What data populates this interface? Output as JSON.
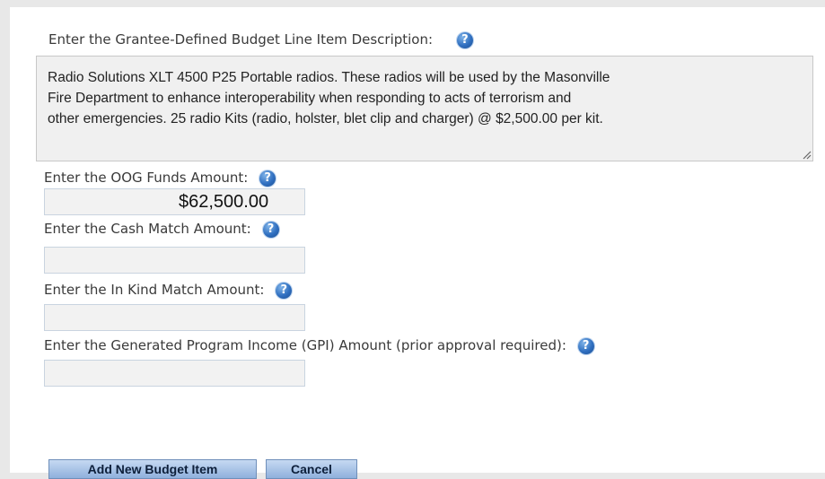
{
  "form": {
    "description_label": "Enter the Grantee-Defined Budget Line Item Description:",
    "description_value": "Radio Solutions XLT 4500 P25 Portable radios. These radios will be used by the Masonville\nFire Department to enhance interoperability when responding to acts of terrorism and\nother emergencies. 25 radio Kits (radio, holster, blet clip and charger) @ $2,500.00 per kit.",
    "oog_label": "Enter the OOG Funds Amount:",
    "oog_value": "$62,500.00",
    "cash_label": "Enter the Cash Match Amount:",
    "cash_value": "",
    "inkind_label": "Enter the In Kind Match Amount:",
    "inkind_value": "",
    "gpi_label": "Enter the Generated Program Income (GPI) Amount (prior approval required):",
    "gpi_value": ""
  },
  "help_icon_glyph": "?",
  "buttons": {
    "add_label": "Add New Budget Item",
    "cancel_label": "Cancel"
  },
  "colors": {
    "help_icon": "#2f6fc0",
    "button_bg": "#a9c4e8"
  }
}
